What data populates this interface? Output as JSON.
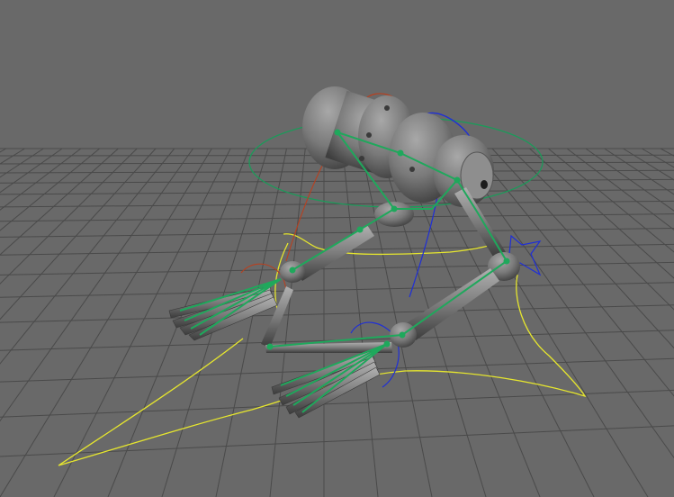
{
  "viewport": {
    "background": "#696969",
    "grid_color": "#4a4a4a",
    "mesh_color": "#8a8a8a",
    "joint_color": "#1fa85c",
    "ik_curve_color": "#e6e62e",
    "control_blue": "#1f2fd6",
    "control_red": "#b8401f",
    "control_green": "#1c9a5a"
  }
}
